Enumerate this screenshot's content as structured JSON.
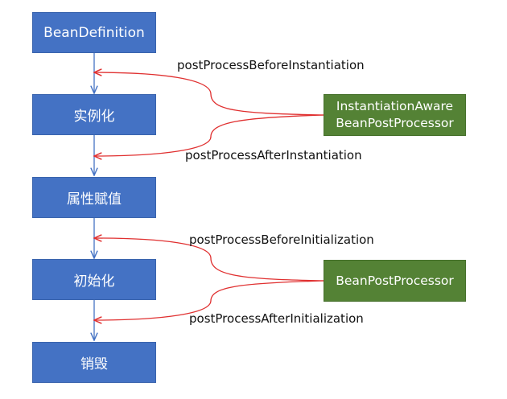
{
  "diagram": {
    "stages": [
      {
        "id": "bean-definition",
        "label": "BeanDefinition"
      },
      {
        "id": "instantiate",
        "label": "实例化"
      },
      {
        "id": "populate",
        "label": "属性赋值"
      },
      {
        "id": "initialize",
        "label": "初始化"
      },
      {
        "id": "destroy",
        "label": "销毁"
      }
    ],
    "processors": [
      {
        "id": "instantiation-aware",
        "label_line1": "InstantiationAware",
        "label_line2": "BeanPostProcessor"
      },
      {
        "id": "bean-post-processor",
        "label": "BeanPostProcessor"
      }
    ],
    "callbacks": [
      {
        "id": "before-instantiation",
        "label": "postProcessBeforeInstantiation"
      },
      {
        "id": "after-instantiation",
        "label": "postProcessAfterInstantiation"
      },
      {
        "id": "before-initialization",
        "label": "postProcessBeforeInitialization"
      },
      {
        "id": "after-initialization",
        "label": "postProcessAfterInitialization"
      }
    ]
  },
  "colors": {
    "stage_fill": "#4472c4",
    "processor_fill": "#548235",
    "flow_arrow": "#4472c4",
    "callback_arrow": "#e03030"
  }
}
